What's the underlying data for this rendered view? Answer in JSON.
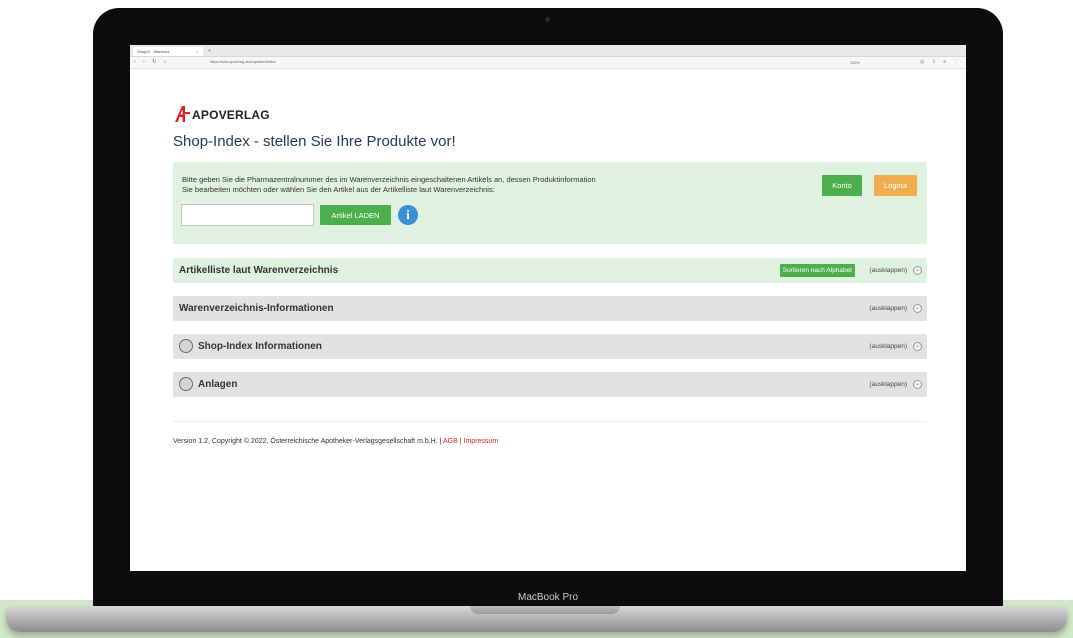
{
  "device": {
    "model_label": "MacBook Pro"
  },
  "browser": {
    "tab_title": "ShopIX - Warenvz.",
    "url": "https://www.apoverlag.at/shopindex/Artikel",
    "zoom_text": "110%"
  },
  "page": {
    "logo_text": "APOVERLAG",
    "title": "Shop-Index - stellen Sie Ihre Produkte vor!",
    "info_panel": {
      "text_line1": "Bitte geben Sie die Pharmazentralnummer des im Warenverzeichnis eingeschaltenen Artikels an, dessen Produktinformation",
      "text_line2": "Sie bearbeiten möchten oder wählen Sie den Artikel aus der Artikelliste laut Warenverzeichnis:",
      "input_value": "",
      "load_button": "Artikel LADEN",
      "info_icon": "i",
      "konto_button": "Konto",
      "logout_button": "Logout"
    },
    "accordions": [
      {
        "title": "Artikelliste laut Warenverzeichnis",
        "sort_button": "Sortieren nach Alphabet",
        "toggle": "(ausklappen)"
      },
      {
        "title": "Warenverzeichnis-Informationen",
        "toggle": "(ausklappen)"
      },
      {
        "title": "Shop-Index Informationen",
        "toggle": "(ausklappen)"
      },
      {
        "title": "Anlagen",
        "toggle": "(ausklappen)"
      }
    ],
    "footer": {
      "text": "Version 1.2, Copyright © 2022, Österreichische Apotheker-Verlagsgesellschaft m.b.H. | ",
      "agb": "AGB",
      "separator": " | ",
      "impressum": "Impressum"
    }
  },
  "colors": {
    "panel_green": "#dff1df",
    "button_green": "#4cae4c",
    "button_orange": "#f0ad4e",
    "logo_red": "#e02020",
    "accordion_gray": "#e2e2e2",
    "info_blue": "#3b8fd6"
  }
}
